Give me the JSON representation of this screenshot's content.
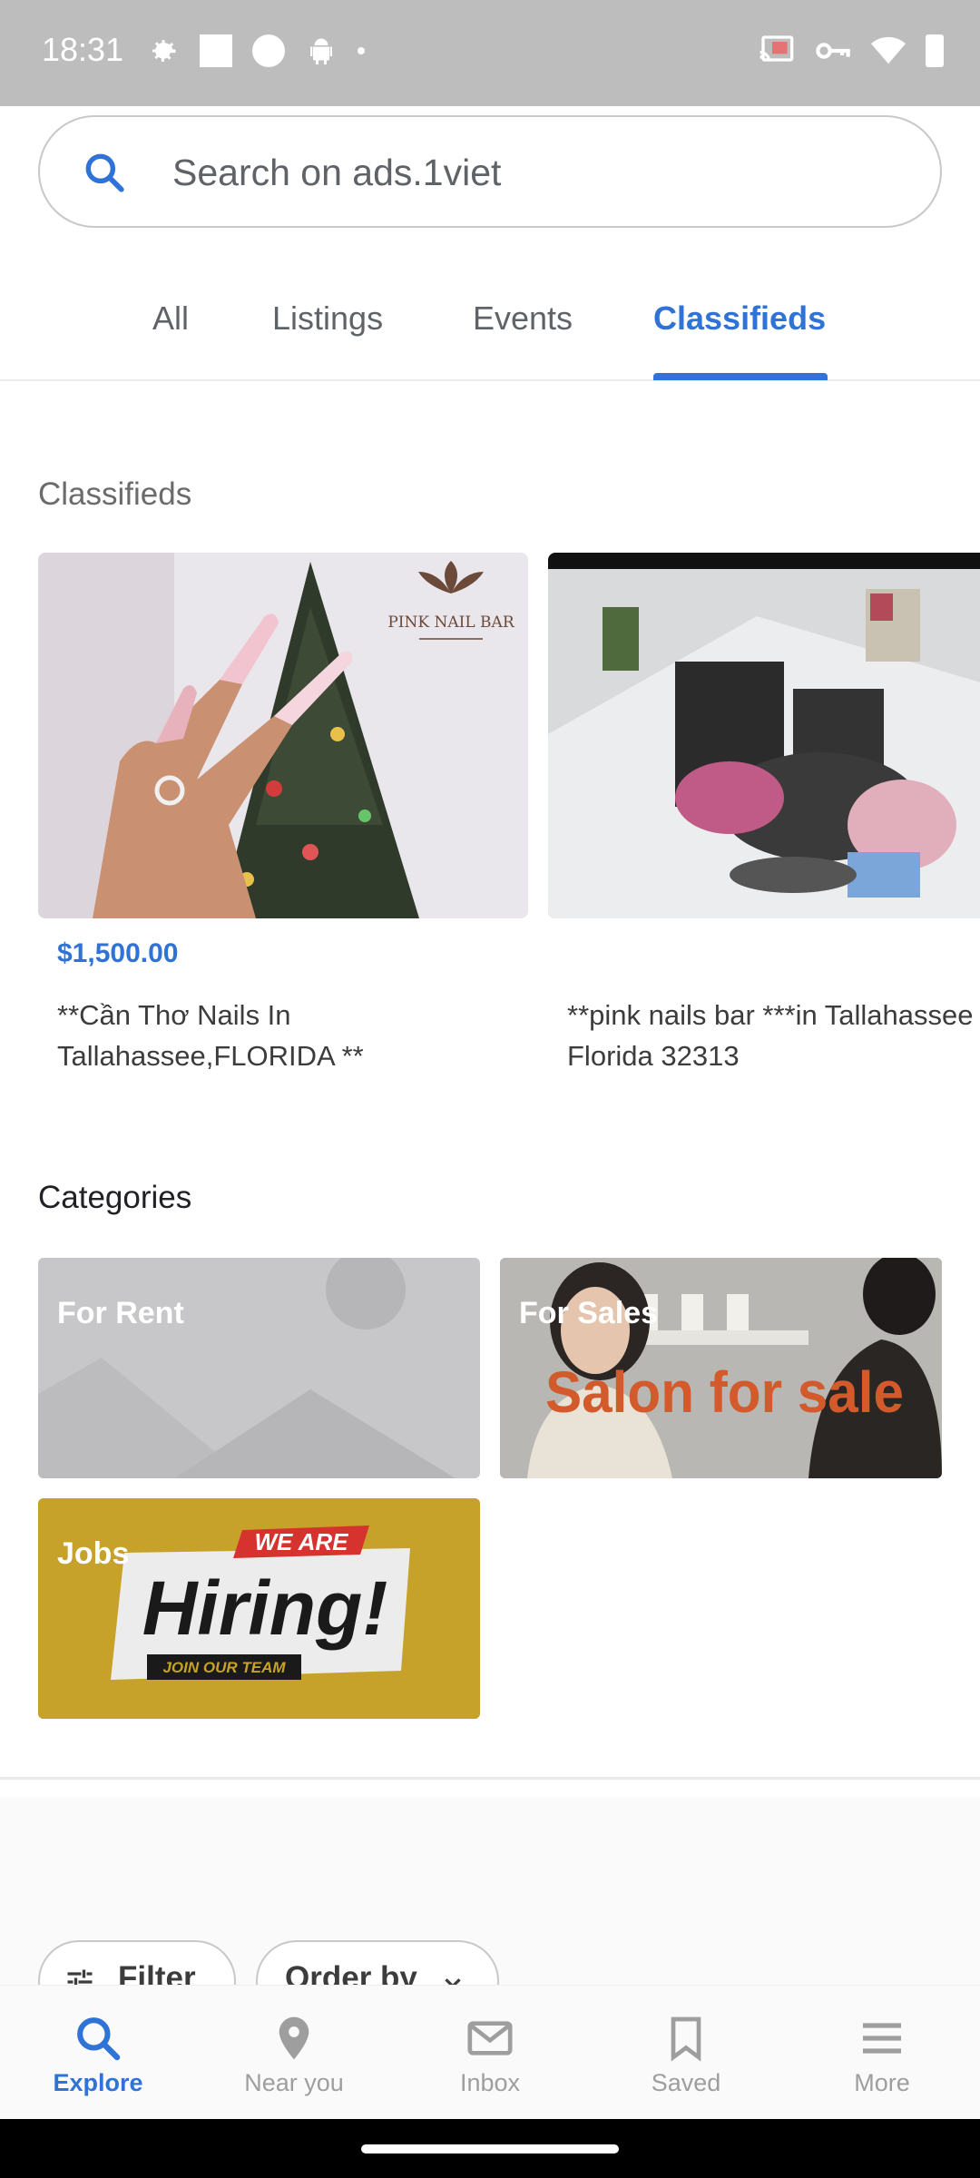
{
  "status_bar": {
    "time": "18:31"
  },
  "search": {
    "placeholder": "Search on ads.1viet"
  },
  "tabs": [
    {
      "label": "All"
    },
    {
      "label": "Listings"
    },
    {
      "label": "Events"
    },
    {
      "label": "Classifieds",
      "active": true
    }
  ],
  "classifieds": {
    "title": "Classifieds",
    "items": [
      {
        "price": "$1,500.00",
        "title": "**Cần Thơ Nails In Tallahassee,FLORIDA **",
        "image_text": "PINK NAIL BAR"
      },
      {
        "price": "",
        "title": "**pink nails bar ***in Tallahassee Florida 32313"
      }
    ]
  },
  "categories": {
    "title": "Categories",
    "items": [
      {
        "label": "For Rent"
      },
      {
        "label": "For Sales",
        "image_text": "Salon for sale"
      },
      {
        "label": "Jobs",
        "image_text_top": "WE ARE",
        "image_text_main": "Hiring!",
        "image_text_bottom": "JOIN OUR TEAM"
      }
    ]
  },
  "filters": {
    "filter_label": "Filter",
    "order_label": "Order by"
  },
  "bottom_nav": [
    {
      "label": "Explore",
      "icon": "search-icon",
      "active": true
    },
    {
      "label": "Near you",
      "icon": "location-pin-icon"
    },
    {
      "label": "Inbox",
      "icon": "mail-icon"
    },
    {
      "label": "Saved",
      "icon": "bookmark-icon"
    },
    {
      "label": "More",
      "icon": "menu-icon"
    }
  ],
  "colors": {
    "accent": "#2f73d6",
    "status_bar": "#bdbdbd",
    "jobs_bg": "#c6a22a"
  }
}
